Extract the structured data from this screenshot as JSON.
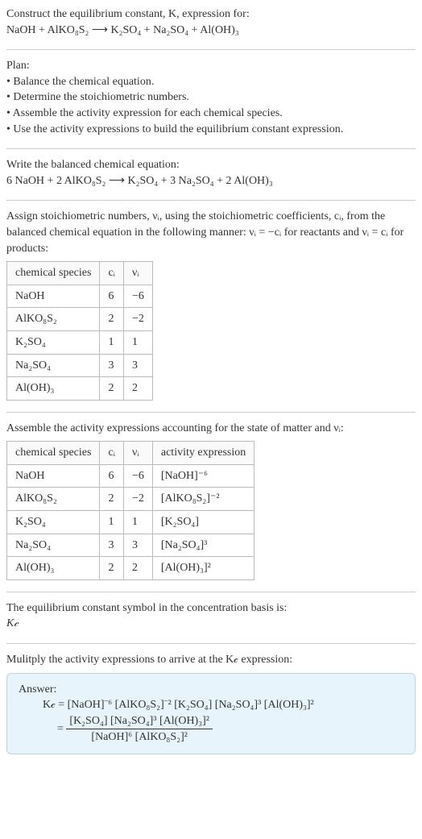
{
  "prompt": {
    "line1": "Construct the equilibrium constant, K, expression for:",
    "equation": "NaOH + AlKO₈S₂  ⟶  K₂SO₄ + Na₂SO₄ + Al(OH)₃"
  },
  "plan": {
    "heading": "Plan:",
    "items": [
      "• Balance the chemical equation.",
      "• Determine the stoichiometric numbers.",
      "• Assemble the activity expression for each chemical species.",
      "• Use the activity expressions to build the equilibrium constant expression."
    ]
  },
  "balanced": {
    "heading": "Write the balanced chemical equation:",
    "equation": "6 NaOH + 2 AlKO₈S₂  ⟶  K₂SO₄ + 3 Na₂SO₄ + 2 Al(OH)₃"
  },
  "assign": {
    "text": "Assign stoichiometric numbers, νᵢ, using the stoichiometric coefficients, cᵢ, from the balanced chemical equation in the following manner: νᵢ = −cᵢ for reactants and νᵢ = cᵢ for products:"
  },
  "table1": {
    "headers": {
      "species": "chemical species",
      "ci": "cᵢ",
      "vi": "νᵢ"
    },
    "rows": [
      {
        "s": "NaOH",
        "c": "6",
        "v": "−6"
      },
      {
        "s": "AlKO₈S₂",
        "c": "2",
        "v": "−2"
      },
      {
        "s": "K₂SO₄",
        "c": "1",
        "v": "1"
      },
      {
        "s": "Na₂SO₄",
        "c": "3",
        "v": "3"
      },
      {
        "s": "Al(OH)₃",
        "c": "2",
        "v": "2"
      }
    ]
  },
  "assemble": {
    "text": "Assemble the activity expressions accounting for the state of matter and νᵢ:"
  },
  "table2": {
    "headers": {
      "species": "chemical species",
      "ci": "cᵢ",
      "vi": "νᵢ",
      "act": "activity expression"
    },
    "rows": [
      {
        "s": "NaOH",
        "c": "6",
        "v": "−6",
        "a": "[NaOH]⁻⁶"
      },
      {
        "s": "AlKO₈S₂",
        "c": "2",
        "v": "−2",
        "a": "[AlKO₈S₂]⁻²"
      },
      {
        "s": "K₂SO₄",
        "c": "1",
        "v": "1",
        "a": "[K₂SO₄]"
      },
      {
        "s": "Na₂SO₄",
        "c": "3",
        "v": "3",
        "a": "[Na₂SO₄]³"
      },
      {
        "s": "Al(OH)₃",
        "c": "2",
        "v": "2",
        "a": "[Al(OH)₃]²"
      }
    ]
  },
  "symbol": {
    "line1": "The equilibrium constant symbol in the concentration basis is:",
    "kc": "K𝒸"
  },
  "multiply": {
    "text": "Mulitply the activity expressions to arrive at the K𝒸 expression:"
  },
  "answer": {
    "label": "Answer:",
    "line1": "K𝒸 = [NaOH]⁻⁶ [AlKO₈S₂]⁻² [K₂SO₄] [Na₂SO₄]³ [Al(OH)₃]²",
    "eq": "=",
    "num": "[K₂SO₄] [Na₂SO₄]³ [Al(OH)₃]²",
    "den": "[NaOH]⁶ [AlKO₈S₂]²"
  },
  "chart_data": {
    "type": "table",
    "tables": [
      {
        "title": "Stoichiometric numbers",
        "columns": [
          "chemical species",
          "cᵢ",
          "νᵢ"
        ],
        "rows": [
          [
            "NaOH",
            6,
            -6
          ],
          [
            "AlKO₈S₂",
            2,
            -2
          ],
          [
            "K₂SO₄",
            1,
            1
          ],
          [
            "Na₂SO₄",
            3,
            3
          ],
          [
            "Al(OH)₃",
            2,
            2
          ]
        ]
      },
      {
        "title": "Activity expressions",
        "columns": [
          "chemical species",
          "cᵢ",
          "νᵢ",
          "activity expression"
        ],
        "rows": [
          [
            "NaOH",
            6,
            -6,
            "[NaOH]^-6"
          ],
          [
            "AlKO₈S₂",
            2,
            -2,
            "[AlKO₈S₂]^-2"
          ],
          [
            "K₂SO₄",
            1,
            1,
            "[K₂SO₄]"
          ],
          [
            "Na₂SO₄",
            3,
            3,
            "[Na₂SO₄]^3"
          ],
          [
            "Al(OH)₃",
            2,
            2,
            "[Al(OH)₃]^2"
          ]
        ]
      }
    ]
  }
}
